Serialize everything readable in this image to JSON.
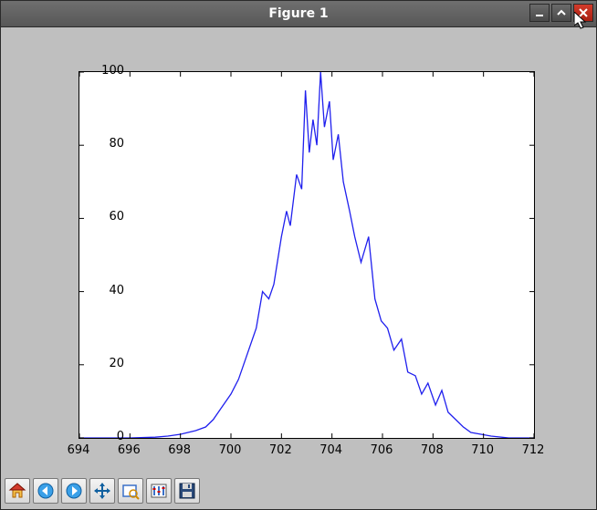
{
  "window": {
    "title": "Figure 1"
  },
  "chart_data": {
    "type": "line",
    "title": "",
    "xlabel": "",
    "ylabel": "",
    "xlim": [
      694,
      712
    ],
    "ylim": [
      0,
      100
    ],
    "xticks": [
      694,
      696,
      698,
      700,
      702,
      704,
      706,
      708,
      710,
      712
    ],
    "yticks": [
      0,
      20,
      40,
      60,
      80,
      100
    ],
    "line_color": "#2020ee",
    "x": [
      694.0,
      696.0,
      697.0,
      697.5,
      698.0,
      698.3,
      698.6,
      699.0,
      699.3,
      699.6,
      700.0,
      700.3,
      700.6,
      701.0,
      701.25,
      701.5,
      701.7,
      702.0,
      702.2,
      702.35,
      702.6,
      702.8,
      702.95,
      703.1,
      703.25,
      703.4,
      703.55,
      703.7,
      703.9,
      704.05,
      704.25,
      704.45,
      704.7,
      704.9,
      705.15,
      705.45,
      705.7,
      705.95,
      706.2,
      706.45,
      706.75,
      707.0,
      707.3,
      707.55,
      707.8,
      708.1,
      708.35,
      708.6,
      708.9,
      709.2,
      709.5,
      709.9,
      710.3,
      711.0,
      712.0
    ],
    "values": [
      0.0,
      0.0,
      0.2,
      0.5,
      1.0,
      1.5,
      2.0,
      3.0,
      5.0,
      8.0,
      12.0,
      16.0,
      22.0,
      30.0,
      40.0,
      38.0,
      42.0,
      55.0,
      62.0,
      58.0,
      72.0,
      68.0,
      95.0,
      78.0,
      87.0,
      80.0,
      100.0,
      85.0,
      92.0,
      76.0,
      83.0,
      70.0,
      62.0,
      55.0,
      48.0,
      55.0,
      38.0,
      32.0,
      30.0,
      24.0,
      27.0,
      18.0,
      17.0,
      12.0,
      15.0,
      9.0,
      13.0,
      7.0,
      5.0,
      3.0,
      1.5,
      1.0,
      0.5,
      0.0,
      0.0
    ]
  },
  "toolbar": {
    "items": [
      {
        "name": "home-icon"
      },
      {
        "name": "back-icon"
      },
      {
        "name": "forward-icon"
      },
      {
        "name": "pan-icon"
      },
      {
        "name": "zoom-icon"
      },
      {
        "name": "configure-icon"
      },
      {
        "name": "save-icon"
      }
    ]
  }
}
